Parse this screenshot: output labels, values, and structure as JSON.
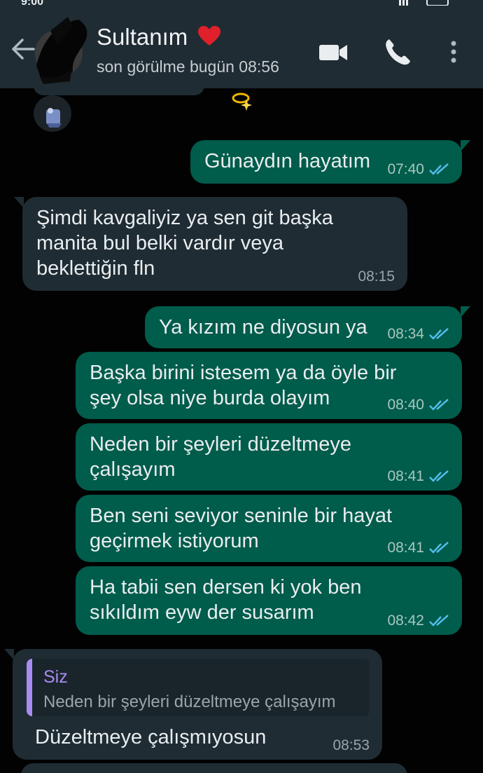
{
  "status_bar": {
    "time": "9:00"
  },
  "header": {
    "contact_name": "Sultanım",
    "heart_emoji": "❤️",
    "last_seen": "son görülme bugün 08:56",
    "icons": [
      "back-arrow-icon",
      "video-call-icon",
      "phone-call-icon",
      "more-options-icon"
    ]
  },
  "messages": [
    {
      "direction": "out",
      "text": "Günaydın hayatım",
      "time": "07:40",
      "read": true
    },
    {
      "direction": "in",
      "text": "Şimdi kavgaliyiz ya sen git başka\nmanita bul belki vardır veya\nbeklettiğin fln",
      "time": "08:15"
    },
    {
      "direction": "out",
      "text": "Ya kızım ne diyosun ya",
      "time": "08:34",
      "read": true
    },
    {
      "direction": "out",
      "text": "Başka birini istesem ya da öyle bir\nşey olsa niye burda olayım",
      "time": "08:40",
      "read": true
    },
    {
      "direction": "out",
      "text": "Neden bir şeyleri düzeltmeye\nçalışayım",
      "time": "08:41",
      "read": true
    },
    {
      "direction": "out",
      "text": "Ben seni seviyor seninle bir hayat\ngeçirmek istiyorum",
      "time": "08:41",
      "read": true
    },
    {
      "direction": "out",
      "text": "Ha tabii sen dersen ki yok ben\nsıkıldım eyw der susarım",
      "time": "08:42",
      "read": true
    },
    {
      "direction": "in",
      "quote": {
        "author": "Siz",
        "text": "Neden bir şeyleri düzeltmeye çalışayım"
      },
      "text": "Düzeltmeye çalışmıyosun",
      "time": "08:53"
    }
  ],
  "colors": {
    "header_bg": "#1f2c33",
    "outgoing_bubble": "#005c4b",
    "incoming_bubble": "#1f2c33",
    "read_ticks": "#53bdeb",
    "quote_accent": "#a98bf2"
  }
}
